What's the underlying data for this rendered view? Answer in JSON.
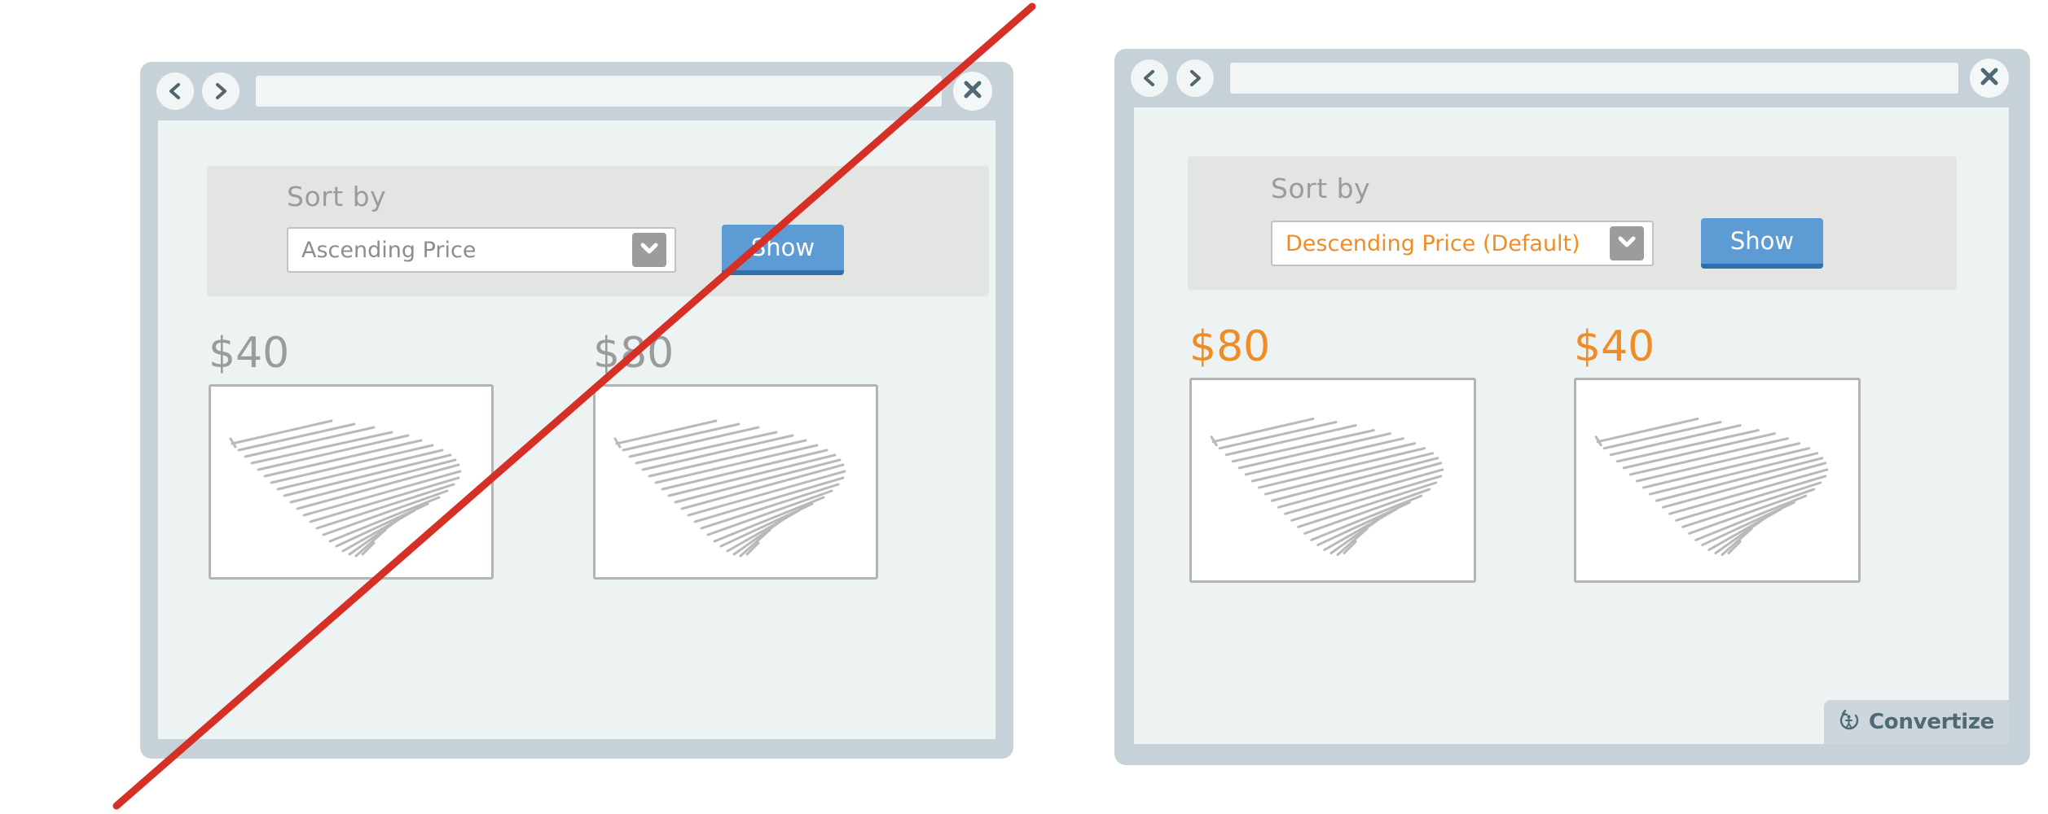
{
  "colors": {
    "window_frame": "#c7d2d8",
    "window_content": "#edf2f3",
    "sort_panel": "#e3e5e3",
    "accent_orange": "#ef8c26",
    "neutral_gray": "#9b9b9b",
    "button_blue": "#5d9bd4",
    "button_blue_shadow": "#2f6fb0",
    "strike_red": "#d62f26",
    "convertize_badge": "#ccd6dc",
    "convertize_text": "#4e6a75"
  },
  "windows": [
    {
      "id": "left",
      "variant": "rejected",
      "titlebar": {
        "back_icon": "chevron-left-icon",
        "forward_icon": "chevron-right-icon",
        "close_icon": "close-icon",
        "url_value": "",
        "url_placeholder": ""
      },
      "sort": {
        "label": "Sort by",
        "select_value": "Ascending Price",
        "select_options": [
          "Ascending Price",
          "Descending Price (Default)"
        ],
        "dropdown_icon": "chevron-down-icon",
        "show_label": "Show"
      },
      "products": [
        {
          "price": "$40",
          "image_icon": "product-sketch-icon"
        },
        {
          "price": "$80",
          "image_icon": "product-sketch-icon"
        }
      ],
      "has_badge": false,
      "struck_through": true
    },
    {
      "id": "right",
      "variant": "recommended",
      "titlebar": {
        "back_icon": "chevron-left-icon",
        "forward_icon": "chevron-right-icon",
        "close_icon": "close-icon",
        "url_value": "",
        "url_placeholder": ""
      },
      "sort": {
        "label": "Sort by",
        "select_value": "Descending Price (Default)",
        "select_options": [
          "Ascending Price",
          "Descending Price (Default)"
        ],
        "dropdown_icon": "chevron-down-icon",
        "show_label": "Show"
      },
      "products": [
        {
          "price": "$80",
          "image_icon": "product-sketch-icon"
        },
        {
          "price": "$40",
          "image_icon": "product-sketch-icon"
        }
      ],
      "has_badge": true,
      "struck_through": false
    }
  ],
  "badge": {
    "name": "Convertize",
    "icon": "convertize-logo-icon"
  },
  "annotation": {
    "strike_icon": "red-diagonal-strike-line"
  }
}
